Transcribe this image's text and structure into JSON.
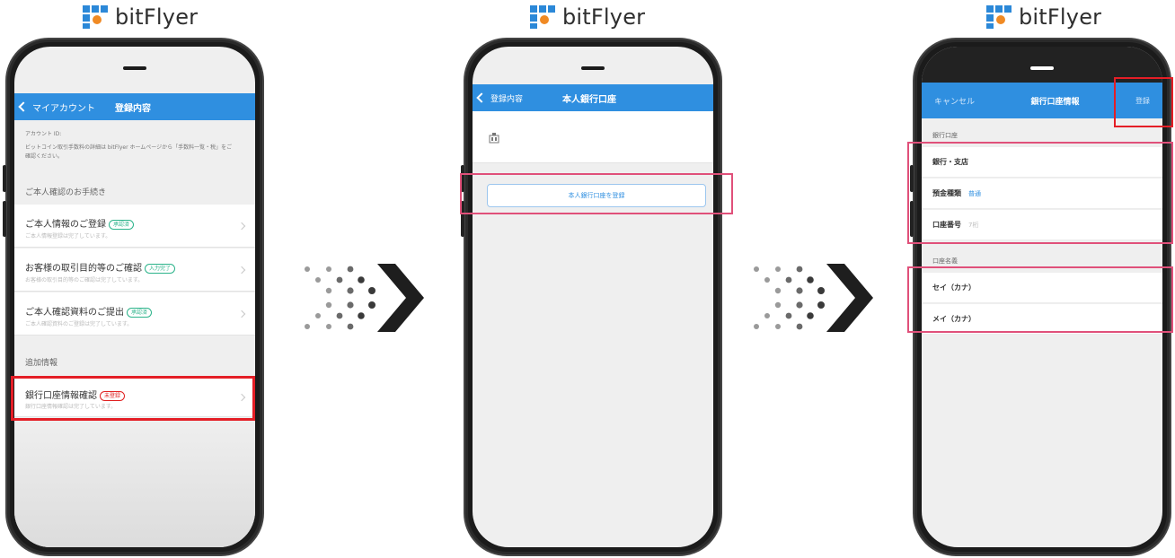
{
  "brand": {
    "name": "bitFlyer"
  },
  "screen1": {
    "nav_back": "マイアカウント",
    "nav_title": "登録内容",
    "account_label": "アカウント ID:",
    "fee_note": "ビットコイン取引手数料の詳細は bitFlyer ホームページから「手数料一覧・税」をご確認ください。",
    "identity_section": "ご本人確認のお手続き",
    "items": [
      {
        "title": "ご本人情報のご登録",
        "badge": "承認済",
        "sub": "ご本人情報登録は完了しています。"
      },
      {
        "title": "お客様の取引目的等のご確認",
        "badge": "入力完了",
        "sub": "お客様の取引目的等のご確認は完了しています。"
      },
      {
        "title": "ご本人確認資料のご提出",
        "badge": "承認済",
        "sub": "ご本人確認資料のご登録は完了しています。"
      }
    ],
    "extra_section": "追加情報",
    "bank_item": {
      "title": "銀行口座情報確認",
      "badge": "未登録",
      "sub": "銀行口座情報確認は完了しています。"
    }
  },
  "screen2": {
    "nav_back": "登録内容",
    "nav_title": "本人銀行口座",
    "register_button": "本人銀行口座を登録"
  },
  "screen3": {
    "cancel": "キャンセル",
    "nav_title": "銀行口座情報",
    "register": "登録",
    "bank_section": "銀行口座",
    "bank_branch": "銀行・支店",
    "deposit_type_label": "預金種類",
    "deposit_type_value": "普通",
    "account_number_label": "口座番号",
    "account_number_placeholder": "7桁",
    "holder_section": "口座名義",
    "sei_label": "セイ（カナ）",
    "mei_label": "メイ（カナ）"
  },
  "colors": {
    "nav_blue": "#2f8fe0",
    "highlight_red": "#e41e26",
    "highlight_pink": "#e0507a",
    "badge_green": "#2bb38a"
  }
}
